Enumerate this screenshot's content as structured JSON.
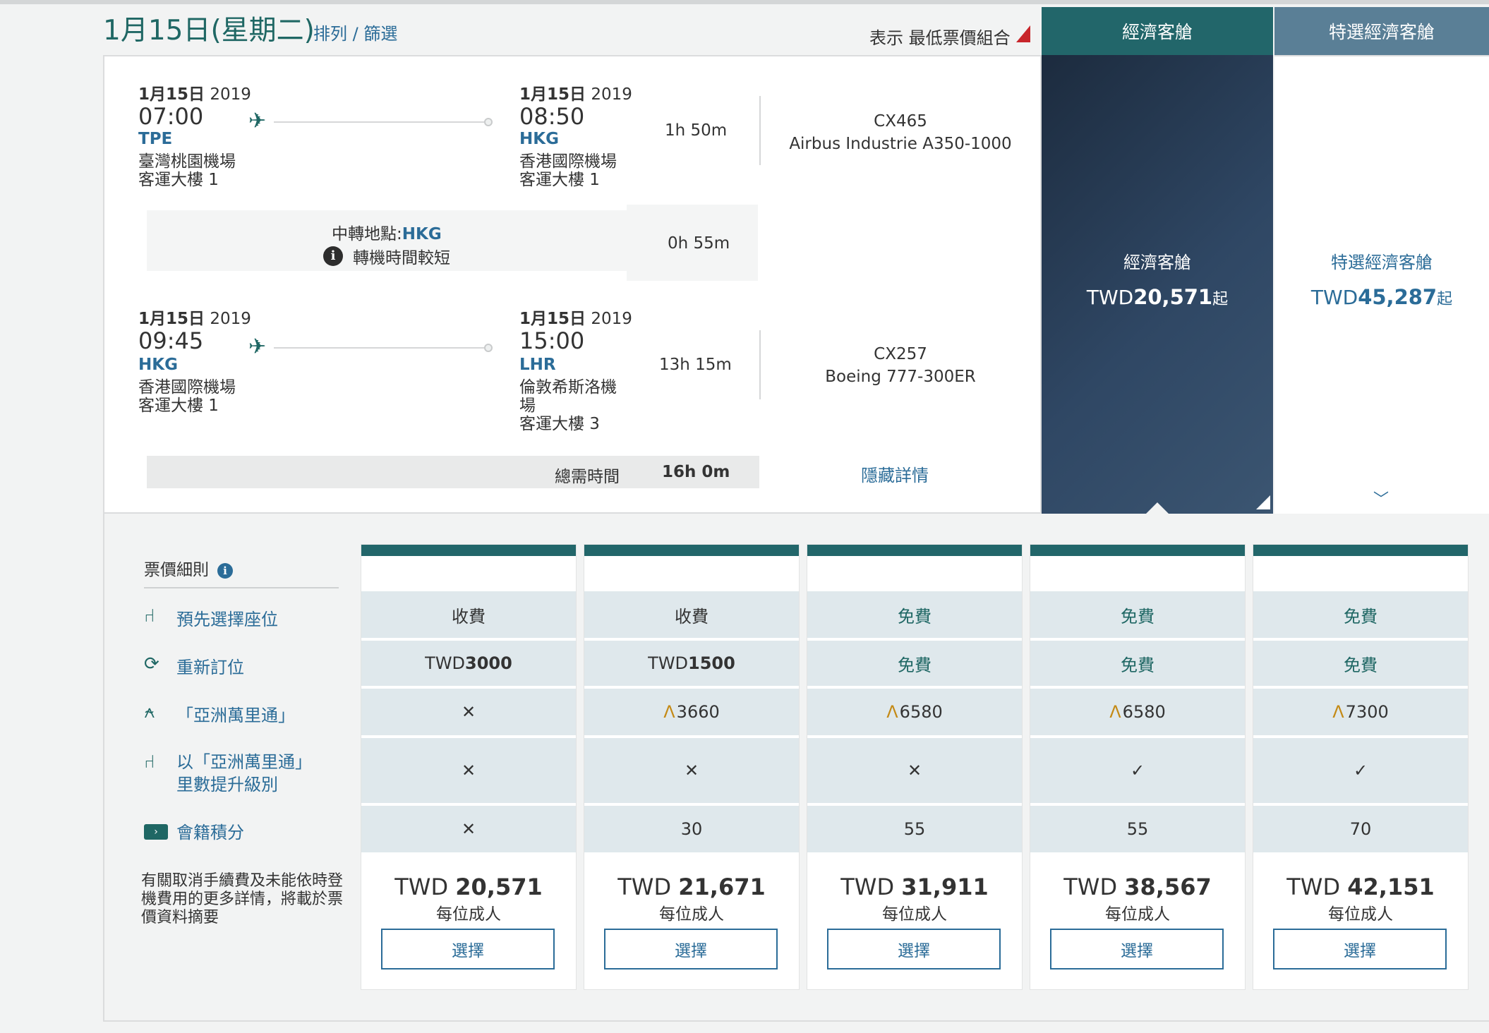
{
  "header": {
    "date": "1月15日(星期二)",
    "sort_link": "排列 / 篩選",
    "show_label": "表示 最低票價組合",
    "tabs": [
      "經濟客艙",
      "特選經濟客艙"
    ]
  },
  "segments": [
    {
      "dep": {
        "date_md": "1月15日",
        "year": "2019",
        "time": "07:00",
        "code": "TPE",
        "airport": "臺灣桃園機場",
        "terminal": "客運大樓 1"
      },
      "arr": {
        "date_md": "1月15日",
        "year": "2019",
        "time": "08:50",
        "code": "HKG",
        "airport": "香港國際機場",
        "terminal": "客運大樓 1"
      },
      "duration": "1h 50m",
      "flight": "CX465",
      "aircraft": "Airbus Industrie A350-1000"
    },
    {
      "dep": {
        "date_md": "1月15日",
        "year": "2019",
        "time": "09:45",
        "code": "HKG",
        "airport": "香港國際機場",
        "terminal": "客運大樓 1"
      },
      "arr": {
        "date_md": "1月15日",
        "year": "2019",
        "time": "15:00",
        "code": "LHR",
        "airport": "倫敦希斯洛機\n場",
        "terminal": "客運大樓 3"
      },
      "duration": "13h 15m",
      "flight": "CX257",
      "aircraft": "Boeing 777-300ER"
    }
  ],
  "transfer": {
    "label": "中轉地點:",
    "code": "HKG",
    "notice": "轉機時間較短",
    "duration": "0h 55m"
  },
  "total": {
    "label": "總需時間",
    "value": "16h 0m"
  },
  "hide_details": "隱藏詳情",
  "cabins": {
    "economy": {
      "label": "經濟客艙",
      "currency": "TWD",
      "amount": "20,571",
      "suffix": "起"
    },
    "premium": {
      "label": "特選經濟客艙",
      "currency": "TWD",
      "amount": "45,287",
      "suffix": "起"
    }
  },
  "rules": {
    "heading": "票價細則",
    "features": [
      "預先選擇座位",
      "重新訂位",
      "「亞洲萬里通」",
      "以「亞洲萬里通」\n里數提升級別",
      "會籍積分"
    ],
    "note": "有關取消手續費及未能依時登機費用的更多詳情，將載於票價資料摘要"
  },
  "fares": [
    {
      "seat": "收費",
      "rebook_pre": "TWD",
      "rebook_bold": "3000",
      "miles": "",
      "miles_mark": "x",
      "upgrade": "x",
      "points": "x",
      "currency": "TWD",
      "price": "20,571",
      "per": "每位成人",
      "button": "選擇"
    },
    {
      "seat": "收費",
      "rebook_pre": "TWD",
      "rebook_bold": "1500",
      "miles": "3660",
      "miles_mark": "am",
      "upgrade": "x",
      "points": "30",
      "currency": "TWD",
      "price": "21,671",
      "per": "每位成人",
      "button": "選擇"
    },
    {
      "seat": "免費",
      "rebook_pre": "",
      "rebook_bold": "免費",
      "miles": "6580",
      "miles_mark": "am",
      "upgrade": "x",
      "points": "55",
      "currency": "TWD",
      "price": "31,911",
      "per": "每位成人",
      "button": "選擇"
    },
    {
      "seat": "免費",
      "rebook_pre": "",
      "rebook_bold": "免費",
      "miles": "6580",
      "miles_mark": "am",
      "upgrade": "check",
      "points": "55",
      "currency": "TWD",
      "price": "38,567",
      "per": "每位成人",
      "button": "選擇"
    },
    {
      "seat": "免費",
      "rebook_pre": "",
      "rebook_bold": "免費",
      "miles": "7300",
      "miles_mark": "am",
      "upgrade": "check",
      "points": "70",
      "currency": "TWD",
      "price": "42,151",
      "per": "每位成人",
      "button": "選擇"
    }
  ],
  "colors": {
    "teal": "#22666a",
    "link": "#2b6c98",
    "cell": "#dfe8ec",
    "navy": "#1c2b3e"
  }
}
